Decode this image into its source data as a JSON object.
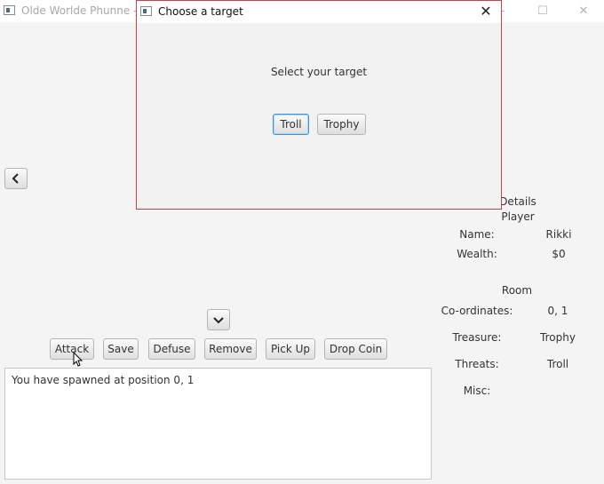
{
  "main_window": {
    "title": "Olde Worlde Phunne - M",
    "controls": {
      "minimize": "–",
      "maximize": "☐",
      "close": "✕"
    }
  },
  "navigation": {
    "back_icon": "chevron-left",
    "down_icon": "chevron-down"
  },
  "action_buttons": [
    "Attack",
    "Save",
    "Defuse",
    "Remove",
    "Pick Up",
    "Drop Coin"
  ],
  "log": {
    "text": "You have spawned at position 0, 1"
  },
  "details": {
    "heading": "Details",
    "player_heading": "Player",
    "name_label": "Name:",
    "name_value": "Rikki",
    "wealth_label": "Wealth:",
    "wealth_value": "$0",
    "room_heading": "Room",
    "coordinates_label": "Co-ordinates:",
    "coordinates_value": "0, 1",
    "treasure_label": "Treasure:",
    "treasure_value": "Trophy",
    "threats_label": "Threats:",
    "threats_value": "Troll",
    "misc_label": "Misc:",
    "misc_value": ""
  },
  "dialog": {
    "title": "Choose a target",
    "close": "✕",
    "prompt": "Select your target",
    "options": [
      "Troll",
      "Trophy"
    ]
  }
}
